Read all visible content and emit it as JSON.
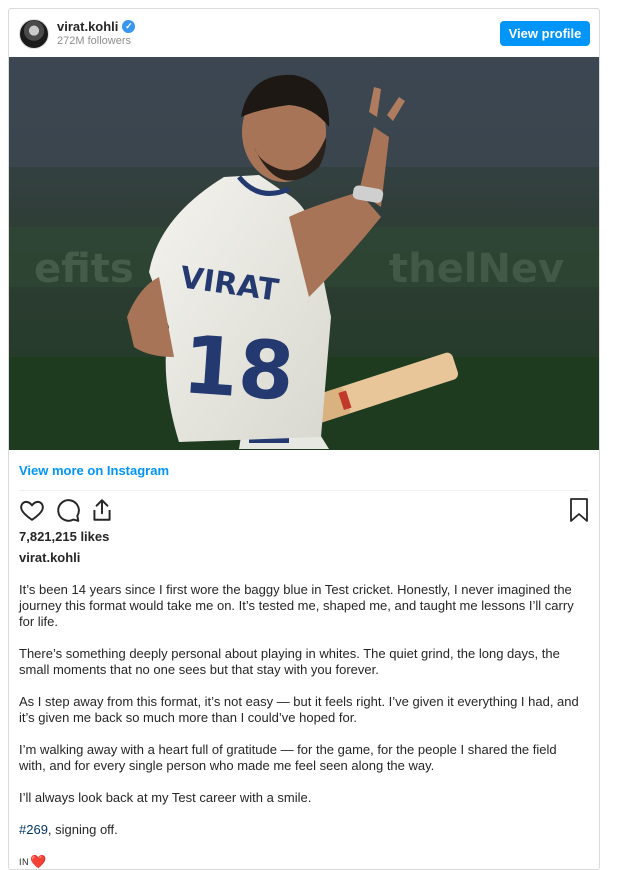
{
  "header": {
    "username": "virat.kohli",
    "verified_icon": "verified-badge-icon",
    "followers": "272M followers",
    "view_profile_label": "View profile"
  },
  "post": {
    "image_icon": "photo",
    "view_more_label": "View more on Instagram",
    "likes": "7,821,215 likes",
    "caption_user": "virat.kohli",
    "paragraphs": [
      "It’s been 14 years since I first wore the baggy blue in Test cricket. Honestly, I never imagined the journey this format would take me on. It’s tested me, shaped me, and taught me lessons I’ll carry for life.",
      "There’s something deeply personal about playing in whites. The quiet grind, the long days, the small moments that no one sees but that stay with you forever.",
      "As I step away from this format, it’s not easy — but it feels right. I’ve given it everything I had, and it’s given me back so much more than I could’ve hoped for.",
      "I’m walking away with a heart full of gratitude — for the game, for the people I shared the field with, and for every single person who made me feel seen along the way.",
      "I’ll always look back at my Test career with a smile."
    ],
    "hashtag": "#269",
    "signoff": ", signing off.",
    "flag_text": "IN",
    "heart_glyph": "❤️",
    "jersey_name": "VIRAT",
    "jersey_number": "18"
  },
  "colors": {
    "accent": "#0095f6",
    "hashtag": "#00376b",
    "heart": "#e0245e"
  }
}
